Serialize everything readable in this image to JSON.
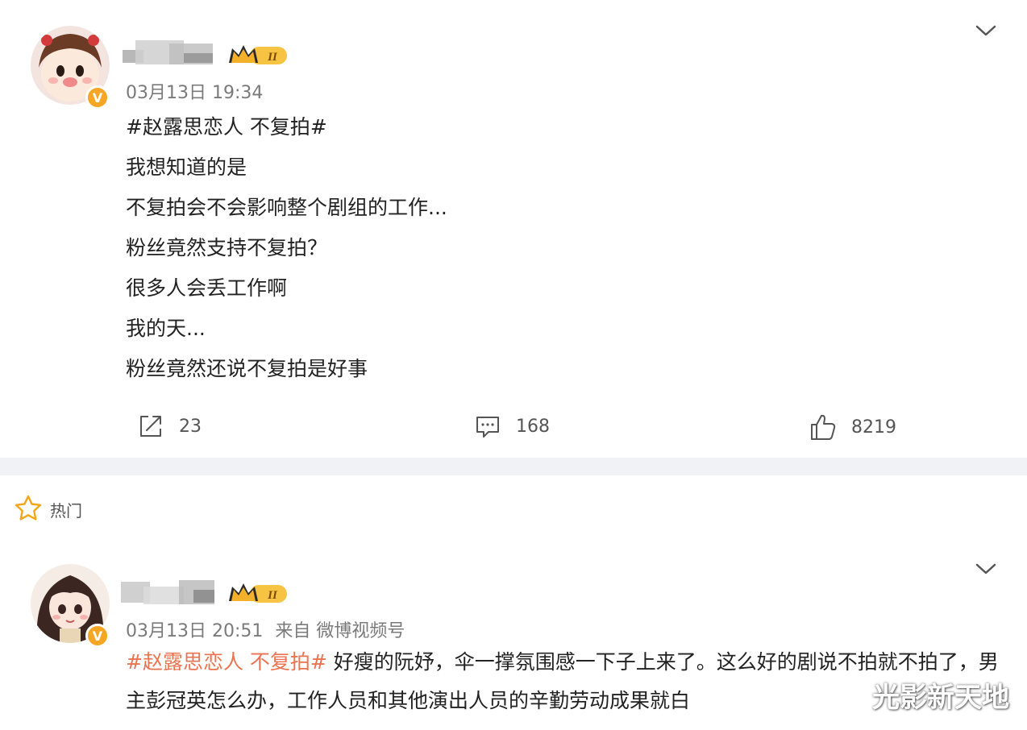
{
  "post": {
    "timestamp": "03月13日 19:34",
    "topic": "#赵露思恋人 不复拍#",
    "lines": [
      "我想知道的是",
      "不复拍会不会影响整个剧组的工作...",
      "粉丝竟然支持不复拍？",
      "很多人会丢工作啊",
      "我的天...",
      "粉丝竟然还说不复拍是好事"
    ],
    "repost_count": "23",
    "comment_count": "168",
    "like_count": "8219",
    "vip_badge": "II",
    "verified_badge": "V"
  },
  "hot_section": {
    "label": "热门"
  },
  "comment": {
    "timestamp": "03月13日 20:51",
    "source": "来自 微博视频号",
    "topic": "#赵露思恋人 不复拍#",
    "text": " 好瘦的阮妤，伞一撑氛围感一下子上来了。这么好的剧说不拍就不拍了，男主彭冠英怎么办，工作人员和其他演出人员的辛勤劳动成果就白",
    "vip_badge": "II",
    "verified_badge": "V"
  },
  "watermark": "光影新天地",
  "colors": {
    "topic": "#eb7350",
    "divider": "#f1f2f5",
    "badge": "#f6a623"
  }
}
